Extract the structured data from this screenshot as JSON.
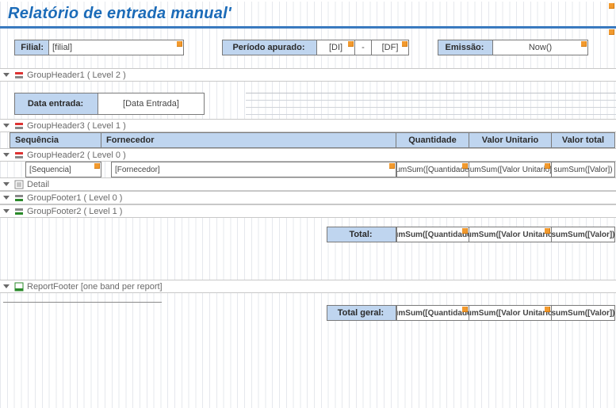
{
  "title": "Relatório de entrada manual'",
  "params": {
    "filial_label": "Filial:",
    "filial_value": "[filial]",
    "periodo_label": "Período apurado:",
    "periodo_di": "[DI]",
    "periodo_dash": "-",
    "periodo_df": "[DF]",
    "emissao_label": "Emissão:",
    "emissao_value": "Now()"
  },
  "bands": {
    "gh1": "GroupHeader1 ( Level 2 )",
    "gh3": "GroupHeader3 ( Level 1 )",
    "gh2": "GroupHeader2 ( Level 0 )",
    "detail": "Detail",
    "gf1": "GroupFooter1 ( Level 0 )",
    "gf2": "GroupFooter2 ( Level 1 )",
    "rf": "ReportFooter [one band per report]"
  },
  "group2": {
    "data_entrada_label": "Data entrada:",
    "data_entrada_value": "[Data Entrada]"
  },
  "columns": {
    "sequencia": "Sequência",
    "fornecedor": "Fornecedor",
    "quantidade": "Quantidade",
    "valor_unitario": "Valor Unitario",
    "valor_total": "Valor total"
  },
  "fields": {
    "sequencia": "[Sequencia]",
    "fornecedor": "[Fornecedor]",
    "sum_qtd": "sumSum([Quantidade])",
    "sum_vu": "sumSum([Valor Unitario])",
    "sum_vt": "sumSum([Valor])"
  },
  "totals": {
    "total_label": "Total:",
    "total_qtd": "sumSum([Quantidade])",
    "total_vu": "sumSum([Valor Unitario])",
    "total_vt": "sumSum([Valor])",
    "grand_label": "Total geral:",
    "grand_qtd": "sumSum([Quantidade])",
    "grand_vu": "sumSum([Valor Unitario])",
    "grand_vt": "sumSum([Valor])"
  }
}
